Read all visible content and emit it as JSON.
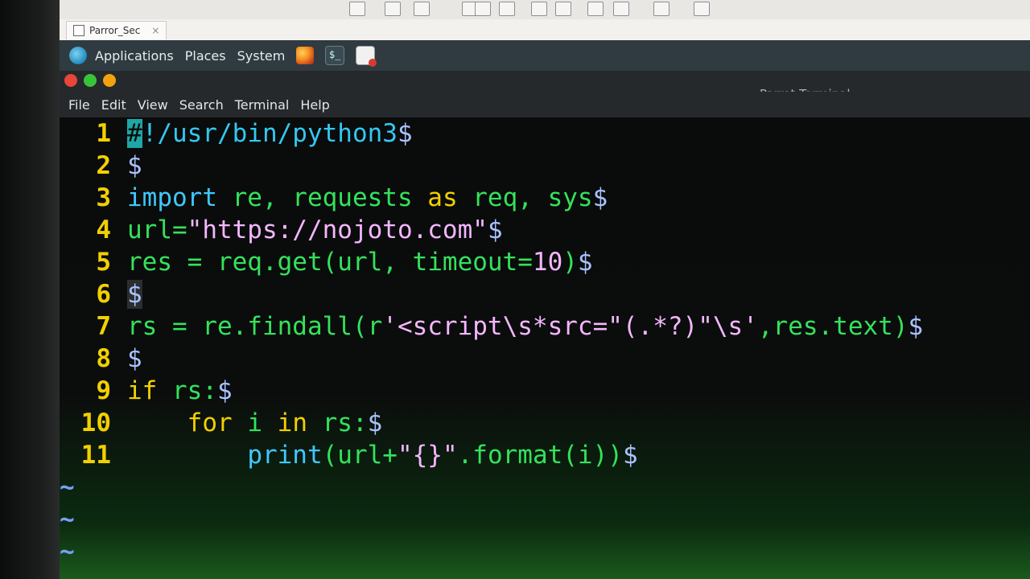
{
  "host": {
    "tab_label": "Parror_Sec",
    "tab_close": "×"
  },
  "panel": {
    "applications": "Applications",
    "places": "Places",
    "system": "System",
    "icons": [
      "firefox-icon",
      "terminal-icon",
      "text-editor-icon"
    ]
  },
  "window": {
    "title": "Parrot Terminal",
    "menu": [
      "File",
      "Edit",
      "View",
      "Search",
      "Terminal",
      "Help"
    ]
  },
  "editor": {
    "lines": [
      {
        "n": "1",
        "segs": [
          [
            "#",
            "cursor"
          ],
          [
            "!/usr/bin/python3",
            "comment"
          ],
          [
            "$",
            "dollar"
          ]
        ]
      },
      {
        "n": "2",
        "segs": [
          [
            "$",
            "dollar"
          ]
        ]
      },
      {
        "n": "3",
        "segs": [
          [
            "import",
            "kw"
          ],
          [
            " re, requests ",
            "id"
          ],
          [
            "as",
            "as"
          ],
          [
            " req, sys",
            "id"
          ],
          [
            "$",
            "dollar"
          ]
        ]
      },
      {
        "n": "4",
        "segs": [
          [
            "url=",
            "id"
          ],
          [
            "\"https://nojoto.com\"",
            "str"
          ],
          [
            "$",
            "dollar"
          ]
        ]
      },
      {
        "n": "5",
        "segs": [
          [
            "res = req.get(url, timeout=",
            "id"
          ],
          [
            "10",
            "num"
          ],
          [
            ")",
            "id"
          ],
          [
            "$",
            "dollar"
          ]
        ]
      },
      {
        "n": "6",
        "segs": [
          [
            "$",
            "dollar-cl"
          ]
        ]
      },
      {
        "n": "7",
        "segs": [
          [
            "rs = re.findall(r",
            "id"
          ],
          [
            "'<script\\s*src=\"(.*?)\"\\s'",
            "str"
          ],
          [
            ",res.text)",
            "id"
          ],
          [
            "$",
            "dollar"
          ]
        ]
      },
      {
        "n": "8",
        "segs": [
          [
            "$",
            "dollar"
          ]
        ]
      },
      {
        "n": "9",
        "segs": [
          [
            "if",
            "if"
          ],
          [
            " rs:",
            "id"
          ],
          [
            "$",
            "dollar"
          ]
        ]
      },
      {
        "n": "10",
        "segs": [
          [
            "    ",
            "plain"
          ],
          [
            "for",
            "if"
          ],
          [
            " i ",
            "id"
          ],
          [
            "in",
            "if"
          ],
          [
            " rs:",
            "id"
          ],
          [
            "$",
            "dollar"
          ]
        ]
      },
      {
        "n": "11",
        "segs": [
          [
            "        ",
            "plain"
          ],
          [
            "print",
            "print"
          ],
          [
            "(url+",
            "id"
          ],
          [
            "\"{}\"",
            "str"
          ],
          [
            ".format(i))",
            "id"
          ],
          [
            "$",
            "dollar"
          ]
        ]
      }
    ],
    "tildes": [
      "~",
      "~",
      "~"
    ]
  },
  "colors": {
    "line_numbers": "#f2d000",
    "identifiers": "#34e25b",
    "strings": "#f4b6ff",
    "keywords": "#40c8ff"
  }
}
